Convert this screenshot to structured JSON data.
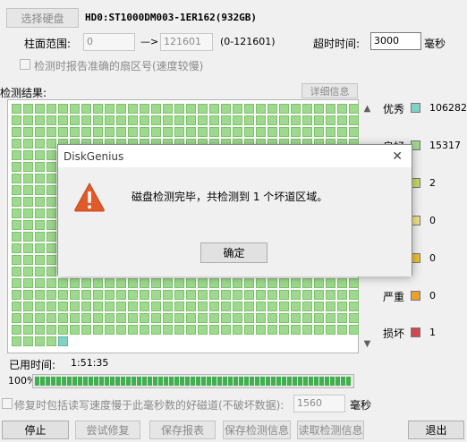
{
  "toolbar": {
    "select_disk": "选择硬盘",
    "disk_name": "HD0:ST1000DM003-1ER162(932GB)"
  },
  "range": {
    "label": "柱面范围:",
    "from": "0",
    "arrow": "—>",
    "to": "121601",
    "span": "(0-121601)"
  },
  "timeout": {
    "label": "超时时间:",
    "value": "3000",
    "unit": "毫秒"
  },
  "report_option": "检测时报告准确的扇区号(速度较慢)",
  "results": {
    "label": "检测结果:",
    "details_button": "详细信息"
  },
  "legend": [
    {
      "label": "优秀",
      "value": "106282",
      "color": "#7fd3c6"
    },
    {
      "label": "良好",
      "value": "15317",
      "color": "#9ed98f"
    },
    {
      "label": "",
      "value": "2",
      "color": "#c8d86a"
    },
    {
      "label": "",
      "value": "0",
      "color": "#f0e08a"
    },
    {
      "label": "",
      "value": "0",
      "color": "#f0c030"
    },
    {
      "label": "严重",
      "value": "0",
      "color": "#e8a030"
    },
    {
      "label": "损坏",
      "value": "1",
      "color": "#d04850"
    }
  ],
  "elapsed": {
    "label": "已用时间:",
    "value": "1:51:35"
  },
  "progress": {
    "percent_text": "100%",
    "fraction": 1.0
  },
  "repair_option": {
    "label": "修复时包括读写速度慢于此毫秒数的好磁道(不破坏数据):",
    "value": "1560",
    "unit": "毫秒"
  },
  "buttons": {
    "stop": "停止",
    "try_repair": "尝试修复",
    "save_report": "保存报表",
    "save_info": "保存检测信息",
    "load_info": "读取检测信息",
    "exit": "退出"
  },
  "dialog": {
    "title": "DiskGenius",
    "message": "磁盘检测完毕，共检测到 1 个坏道区域。",
    "ok": "确定",
    "close_glyph": "✕"
  },
  "icons": {
    "warning": "warning-icon",
    "scroll_up": "▲",
    "scroll_down": "▼"
  }
}
